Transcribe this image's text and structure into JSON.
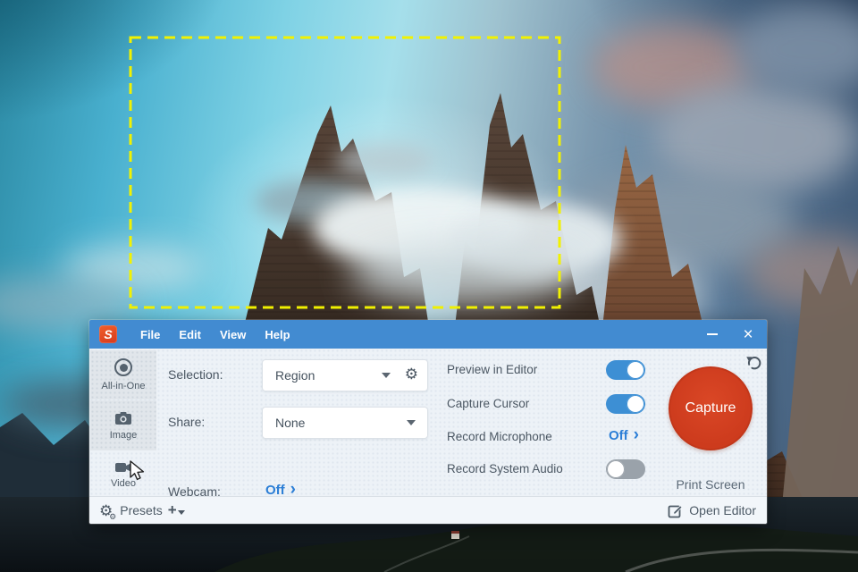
{
  "logo": {
    "letter": "S"
  },
  "menu": {
    "items": [
      "File",
      "Edit",
      "View",
      "Help"
    ]
  },
  "window_controls": {
    "minimize": "–",
    "close": "×"
  },
  "sidebar": {
    "tabs": [
      {
        "label": "All-in-One"
      },
      {
        "label": "Image"
      },
      {
        "label": "Video"
      }
    ]
  },
  "capture_settings": {
    "selection": {
      "label": "Selection:",
      "value": "Region"
    },
    "share": {
      "label": "Share:",
      "value": "None"
    },
    "webcam": {
      "label": "Webcam:",
      "value": "Off",
      "chevron": "›"
    }
  },
  "options": {
    "preview_in_editor": {
      "label": "Preview in Editor",
      "state": "on"
    },
    "capture_cursor": {
      "label": "Capture Cursor",
      "state": "on"
    },
    "record_microphone": {
      "label": "Record Microphone",
      "value": "Off",
      "chevron": "›",
      "state": "off"
    },
    "record_system_audio": {
      "label": "Record System Audio",
      "state": "off"
    }
  },
  "capture": {
    "button": "Capture",
    "shortcut": "Print Screen"
  },
  "footer": {
    "presets": "Presets",
    "plus": "+",
    "open_editor": "Open Editor"
  },
  "icons": {
    "gear": "⚙",
    "gear_small": "⚙"
  },
  "colors": {
    "titlebar_blue": "#428bd1",
    "accent_blue": "#2b7ed6",
    "capture_red": "#cd3b1d",
    "selection_dash_yellow": "#f2f200",
    "toggle_on": "#3d8fd4",
    "toggle_off": "#9aa2aa",
    "panel_bg": "#edf2f7"
  }
}
